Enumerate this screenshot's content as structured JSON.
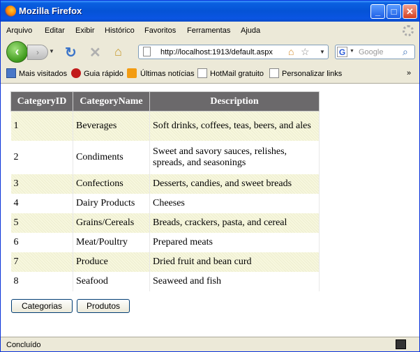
{
  "window": {
    "title": "Mozilla Firefox"
  },
  "menu": [
    "Arquivo",
    "Editar",
    "Exibir",
    "Histórico",
    "Favoritos",
    "Ferramentas",
    "Ajuda"
  ],
  "nav": {
    "url": "http://localhost:1913/default.aspx",
    "search_placeholder": "Google"
  },
  "bookmarks": [
    "Mais visitados",
    "Guia rápido",
    "Últimas notícias",
    "HotMail gratuito",
    "Personalizar links"
  ],
  "table": {
    "headers": [
      "CategoryID",
      "CategoryName",
      "Description"
    ],
    "rows": [
      [
        "1",
        "Beverages",
        "Soft drinks, coffees, teas, beers, and ales"
      ],
      [
        "2",
        "Condiments",
        "Sweet and savory sauces, relishes, spreads, and seasonings"
      ],
      [
        "3",
        "Confections",
        "Desserts, candies, and sweet breads"
      ],
      [
        "4",
        "Dairy Products",
        "Cheeses"
      ],
      [
        "5",
        "Grains/Cereals",
        "Breads, crackers, pasta, and cereal"
      ],
      [
        "6",
        "Meat/Poultry",
        "Prepared meats"
      ],
      [
        "7",
        "Produce",
        "Dried fruit and bean curd"
      ],
      [
        "8",
        "Seafood",
        "Seaweed and fish"
      ]
    ]
  },
  "buttons": {
    "categories": "Categorias",
    "products": "Produtos"
  },
  "status": {
    "text": "Concluído"
  },
  "colors": {
    "title_bar": "#0553d6",
    "header_bg": "#6b696b",
    "alt_row": "#f7f7de"
  }
}
